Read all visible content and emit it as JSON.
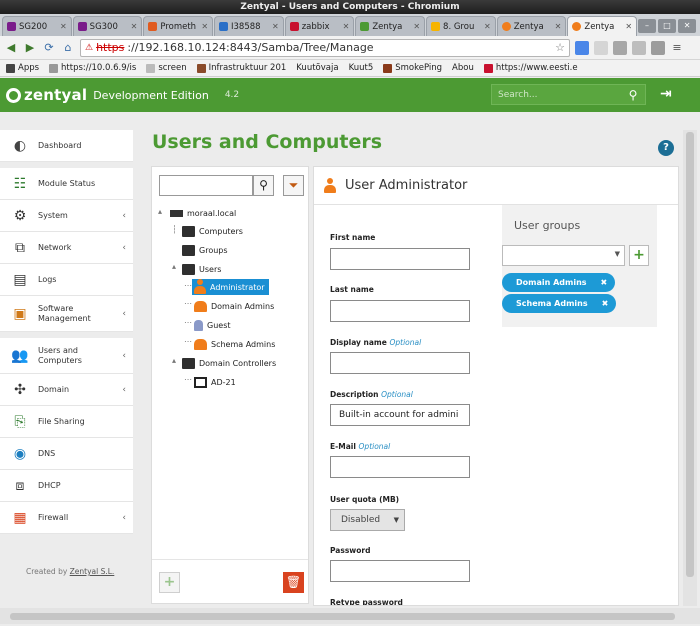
{
  "window": {
    "title": "Zentyal - Users and Computers - Chromium"
  },
  "tabs": [
    {
      "label": "SG200",
      "color": "#7a1c8a"
    },
    {
      "label": "SG300",
      "color": "#7a1c8a"
    },
    {
      "label": "Prometh",
      "color": "#e05b20"
    },
    {
      "label": "I38588",
      "color": "#2a6fc7"
    },
    {
      "label": "zabbix",
      "color": "#c8102e"
    },
    {
      "label": "Zentya",
      "color": "#4c9a33"
    },
    {
      "label": "8. Grou",
      "color": "#f6b400"
    },
    {
      "label": "Zentya",
      "color": "#f07d1b"
    },
    {
      "label": "Zentya",
      "color": "#f07d1b",
      "active": true
    }
  ],
  "address": {
    "scheme": "https",
    "rest": "://192.168.10.124:8443/Samba/Tree/Manage"
  },
  "bookmarks": [
    {
      "label": "Apps",
      "color": "#444"
    },
    {
      "label": "https://10.0.6.9/is",
      "color": "#555"
    },
    {
      "label": "screen",
      "color": "#999"
    },
    {
      "label": "Infrastruktuur 201",
      "color": "#8a4b2a"
    },
    {
      "label": "Kuutõvaja",
      "color": "#555"
    },
    {
      "label": "Kuut5",
      "color": "#777"
    },
    {
      "label": "SmokePing",
      "color": "#8a3a1a"
    },
    {
      "label": "Abou",
      "color": "#777"
    },
    {
      "label": "https://www.eesti.e",
      "color": "#c8102e"
    }
  ],
  "header": {
    "brand": "zentyal",
    "edition": "Development Edition",
    "version": "4.2",
    "search_placeholder": "Search..."
  },
  "sidebar": {
    "items": [
      {
        "name": "dashboard",
        "label": "Dashboard",
        "icon": "dashboard-icon",
        "caret": false
      },
      {
        "name": "module-status",
        "label": "Module Status",
        "icon": "module-status-icon",
        "caret": false
      },
      {
        "name": "system",
        "label": "System",
        "icon": "gear-icon",
        "caret": true
      },
      {
        "name": "network",
        "label": "Network",
        "icon": "network-icon",
        "caret": true
      },
      {
        "name": "logs",
        "label": "Logs",
        "icon": "logs-icon",
        "caret": false
      },
      {
        "name": "software",
        "label": "Software Management",
        "icon": "package-icon",
        "caret": true
      },
      {
        "name": "users",
        "label": "Users and Computers",
        "icon": "users-icon",
        "caret": true
      },
      {
        "name": "domain",
        "label": "Domain",
        "icon": "domain-icon",
        "caret": true
      },
      {
        "name": "file-sharing",
        "label": "File Sharing",
        "icon": "file-sharing-icon",
        "caret": false
      },
      {
        "name": "dns",
        "label": "DNS",
        "icon": "dns-icon",
        "caret": false
      },
      {
        "name": "dhcp",
        "label": "DHCP",
        "icon": "dhcp-icon",
        "caret": false
      },
      {
        "name": "firewall",
        "label": "Firewall",
        "icon": "firewall-icon",
        "caret": true
      }
    ],
    "credits_prefix": "Created by",
    "credits_link": "Zentyal S.L."
  },
  "main": {
    "title": "Users and Computers",
    "tree": {
      "root": "moraal.local",
      "nodes": [
        {
          "label": "Computers",
          "type": "folder"
        },
        {
          "label": "Groups",
          "type": "folder"
        },
        {
          "label": "Users",
          "type": "folder"
        },
        {
          "label": "Administrator",
          "type": "user",
          "selected": true
        },
        {
          "label": "Domain Admins",
          "type": "group"
        },
        {
          "label": "Guest",
          "type": "user-guest"
        },
        {
          "label": "Schema Admins",
          "type": "group"
        },
        {
          "label": "Domain Controllers",
          "type": "folder"
        },
        {
          "label": "AD-21",
          "type": "computer"
        }
      ]
    },
    "user": {
      "header": "User Administrator",
      "fields": [
        {
          "label": "First name",
          "optional": "",
          "value": ""
        },
        {
          "label": "Last name",
          "optional": "",
          "value": ""
        },
        {
          "label": "Display name",
          "optional": "Optional",
          "value": ""
        },
        {
          "label": "Description",
          "optional": "Optional",
          "value": "Built-in account for admini"
        },
        {
          "label": "E-Mail",
          "optional": "Optional",
          "value": ""
        },
        {
          "label": "User quota (MB)",
          "optional": "",
          "value": "Disabled"
        },
        {
          "label": "Password",
          "optional": "",
          "value": ""
        },
        {
          "label": "Retype password",
          "optional": "",
          "value": ""
        }
      ],
      "groups_title": "User groups",
      "groups": [
        "Domain Admins",
        "Schema Admins"
      ]
    }
  },
  "colors": {
    "brand_green": "#4c9a33",
    "selection_blue": "#1a8fd3",
    "pill_blue": "#1d9ad6",
    "delete_red": "#d9431f",
    "user_orange": "#f07d1b"
  }
}
